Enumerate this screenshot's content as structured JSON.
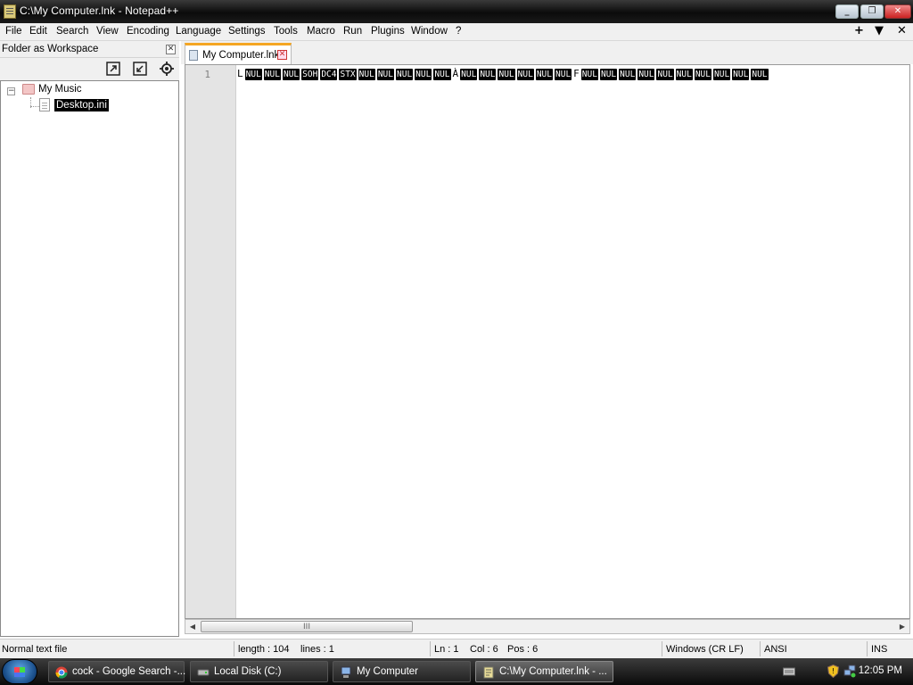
{
  "window": {
    "title": "C:\\My Computer.lnk - Notepad++"
  },
  "menu": [
    "File",
    "Edit",
    "Search",
    "View",
    "Encoding",
    "Language",
    "Settings",
    "Tools",
    "Macro",
    "Run",
    "Plugins",
    "Window",
    "?"
  ],
  "menu_right": {
    "add": "+",
    "dropdown": "▼",
    "close": "✕"
  },
  "workspace": {
    "title": "Folder as Workspace",
    "tree": {
      "folder": "My Music",
      "file": "Desktop.ini"
    }
  },
  "tab": {
    "label": "My Computer.lnk"
  },
  "editor": {
    "line_number": "1",
    "tokens": [
      {
        "t": "L",
        "ctrl": false
      },
      {
        "t": "NUL",
        "ctrl": true
      },
      {
        "t": "NUL",
        "ctrl": true
      },
      {
        "t": "NUL",
        "ctrl": true
      },
      {
        "t": "SOH",
        "ctrl": true
      },
      {
        "t": "DC4",
        "ctrl": true
      },
      {
        "t": "STX",
        "ctrl": true
      },
      {
        "t": "NUL",
        "ctrl": true
      },
      {
        "t": "NUL",
        "ctrl": true
      },
      {
        "t": "NUL",
        "ctrl": true
      },
      {
        "t": "NUL",
        "ctrl": true
      },
      {
        "t": "NUL",
        "ctrl": true
      },
      {
        "t": "À",
        "ctrl": false
      },
      {
        "t": "NUL",
        "ctrl": true
      },
      {
        "t": "NUL",
        "ctrl": true
      },
      {
        "t": "NUL",
        "ctrl": true
      },
      {
        "t": "NUL",
        "ctrl": true
      },
      {
        "t": "NUL",
        "ctrl": true
      },
      {
        "t": "NUL",
        "ctrl": true
      },
      {
        "t": "F",
        "ctrl": false
      },
      {
        "t": "NUL",
        "ctrl": true
      },
      {
        "t": "NUL",
        "ctrl": true
      },
      {
        "t": "NUL",
        "ctrl": true
      },
      {
        "t": "NUL",
        "ctrl": true
      },
      {
        "t": "NUL",
        "ctrl": true
      },
      {
        "t": "NUL",
        "ctrl": true
      },
      {
        "t": "NUL",
        "ctrl": true
      },
      {
        "t": "NUL",
        "ctrl": true
      },
      {
        "t": "NUL",
        "ctrl": true
      },
      {
        "t": "NUL",
        "ctrl": true
      }
    ],
    "scroll_thumb_glyph": "III"
  },
  "status": {
    "file_type": "Normal text file",
    "length": "length : 104",
    "lines": "lines : 1",
    "ln": "Ln : 1",
    "col": "Col : 6",
    "pos": "Pos : 6",
    "eol": "Windows (CR LF)",
    "encoding": "ANSI",
    "mode": "INS"
  },
  "taskbar": {
    "buttons": [
      {
        "label": "cock - Google Search -...",
        "icon": "chrome-icon"
      },
      {
        "label": "Local Disk (C:)",
        "icon": "drive-icon"
      },
      {
        "label": "My Computer",
        "icon": "computer-icon"
      },
      {
        "label": "C:\\My Computer.lnk - ...",
        "icon": "notepadpp-icon"
      }
    ],
    "clock": "12:05 PM"
  },
  "colors": {
    "tab_accent": "#f5a623",
    "ctrl_char_bg": "#000000",
    "ctrl_char_fg": "#ffffff",
    "close_red": "#c22"
  }
}
